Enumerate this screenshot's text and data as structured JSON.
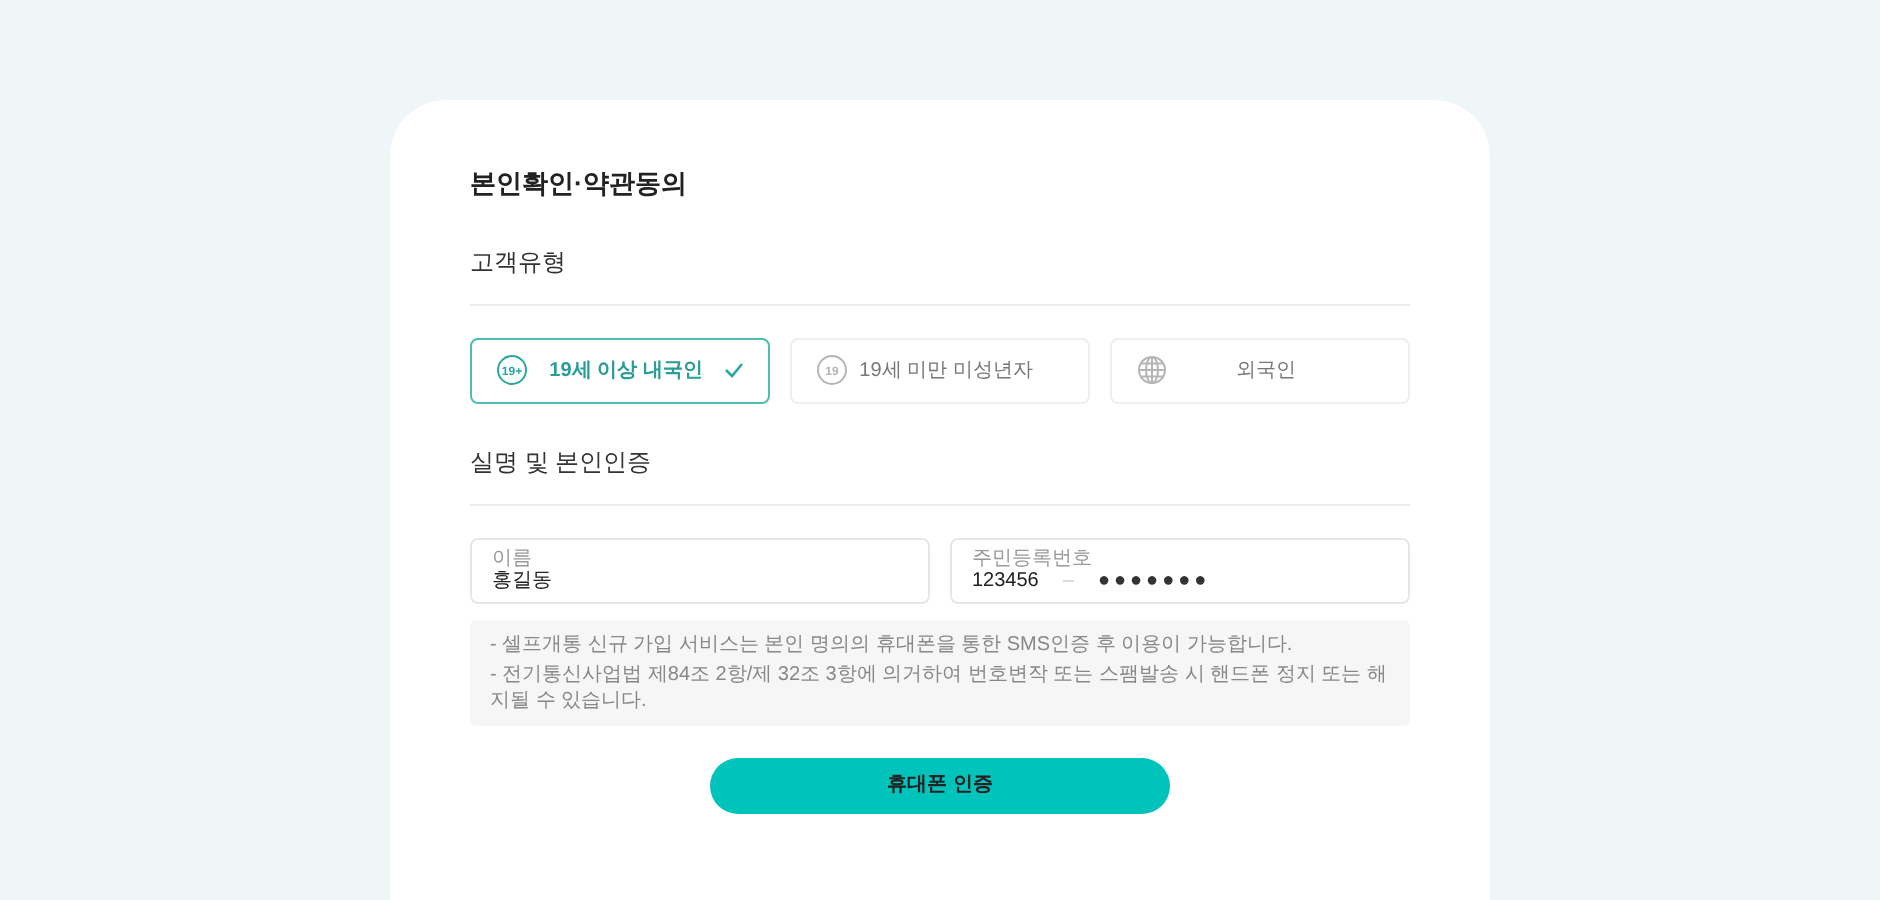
{
  "title": "본인확인·약관동의",
  "customer_type": {
    "heading": "고객유형",
    "options": [
      {
        "kind": "age",
        "badge": "19+",
        "label": "19세 이상 내국인",
        "selected": true
      },
      {
        "kind": "age",
        "badge": "19",
        "label": "19세 미만 미성년자",
        "selected": false
      },
      {
        "kind": "globe",
        "label": "외국인",
        "selected": false
      }
    ]
  },
  "verification": {
    "heading": "실명 및 본인인증",
    "name_field": {
      "label": "이름",
      "value": "홍길동"
    },
    "id_field": {
      "label": "주민등록번호",
      "front": "123456",
      "separator": "–",
      "back": "●●●●●●●"
    },
    "notes": [
      "- 셀프개통 신규 가입 서비스는 본인 명의의 휴대폰을 통한 SMS인증 후 이용이 가능합니다.",
      "- 전기통신사업법 제84조 2항/제 32조 3항에 의거하여 번호변작 또는 스팸발송 시 핸드폰 정지 또는 해지될 수 있습니다."
    ]
  },
  "submit": "휴대폰 인증"
}
